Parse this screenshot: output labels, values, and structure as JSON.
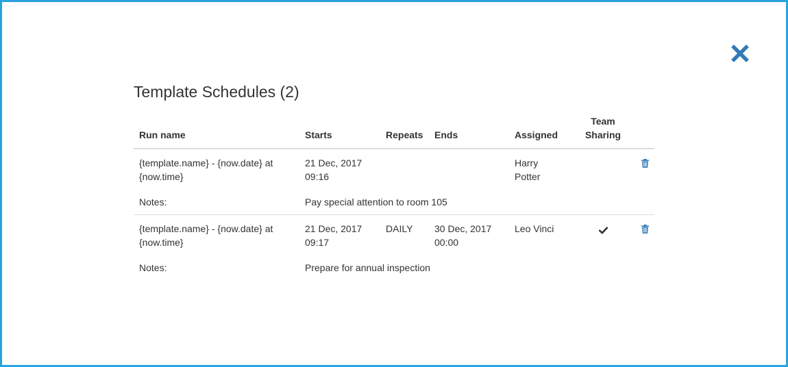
{
  "modal": {
    "title": "Template Schedules (2)"
  },
  "table": {
    "headers": {
      "run_name": "Run name",
      "starts": "Starts",
      "repeats": "Repeats",
      "ends": "Ends",
      "assigned": "Assigned",
      "team_sharing_line1": "Team",
      "team_sharing_line2": "Sharing"
    },
    "notes_label": "Notes:",
    "rows": [
      {
        "run_name_line1": "{template.name} - {now.date} at",
        "run_name_line2": "{now.time}",
        "starts_date": "21 Dec, 2017",
        "starts_time": "09:16",
        "repeats": "",
        "ends_date": "",
        "ends_time": "",
        "assigned_line1": "Harry",
        "assigned_line2": "Potter",
        "team_sharing": false,
        "notes": "Pay special attention to room 105"
      },
      {
        "run_name_line1": "{template.name} - {now.date} at",
        "run_name_line2": "{now.time}",
        "starts_date": "21 Dec, 2017",
        "starts_time": "09:17",
        "repeats": "DAILY",
        "ends_date": "30 Dec, 2017",
        "ends_time": "00:00",
        "assigned_line1": "Leo Vinci",
        "assigned_line2": "",
        "team_sharing": true,
        "notes": "Prepare for annual inspection"
      }
    ]
  },
  "icons": {
    "close": "close-icon",
    "trash": "trash-icon",
    "check": "check-icon"
  },
  "colors": {
    "modal_border": "#2aa3dd",
    "accent": "#337ab7",
    "text": "#333333"
  }
}
